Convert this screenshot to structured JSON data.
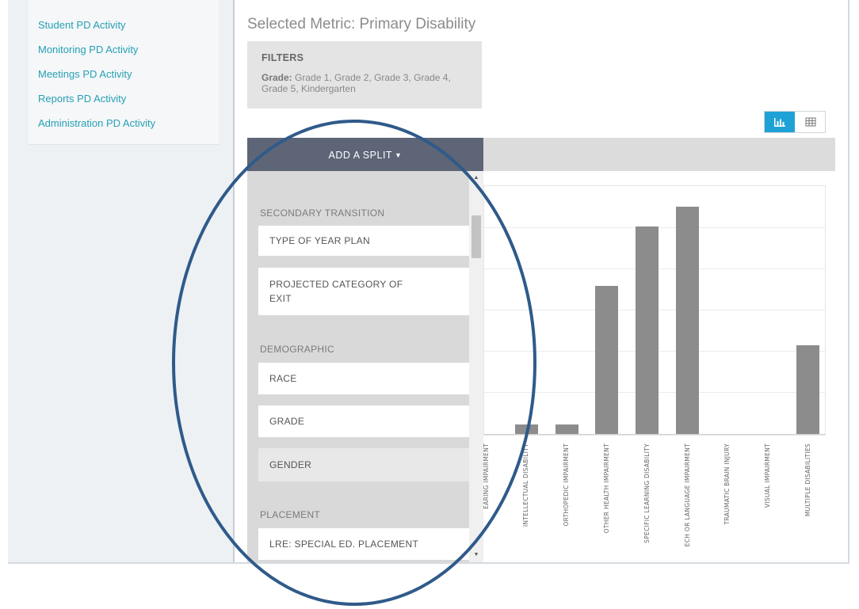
{
  "sidebar": {
    "links": [
      "Student PD Activity",
      "Monitoring PD Activity",
      "Meetings PD Activity",
      "Reports PD Activity",
      "Administration PD Activity"
    ]
  },
  "header": {
    "title": "Selected Metric: Primary Disability"
  },
  "filters": {
    "title": "FILTERS",
    "grade_label": "Grade:",
    "grade_value": "Grade 1, Grade 2, Grade 3, Grade 4, Grade 5, Kindergarten"
  },
  "view_toggle": {
    "chart_icon": "bar-chart-icon",
    "table_icon": "table-grid-icon",
    "active": "chart",
    "active_color": "#1ea2d6"
  },
  "split": {
    "button_label": "ADD A SPLIT",
    "caret_icon": "caret-down-icon"
  },
  "dropdown": {
    "sections": [
      {
        "label": "SECONDARY TRANSITION",
        "items": [
          "TYPE OF YEAR PLAN",
          "PROJECTED CATEGORY OF EXIT"
        ]
      },
      {
        "label": "DEMOGRAPHIC",
        "items": [
          "RACE",
          "GRADE",
          "GENDER"
        ]
      },
      {
        "label": "PLACEMENT",
        "items": [
          "LRE: SPECIAL ED. PLACEMENT"
        ]
      }
    ],
    "hovered_item": "GENDER"
  },
  "chart_data": {
    "type": "bar",
    "categories": [
      "HEARING IMPAIRMENT",
      "INTELLECTUAL DISABILITY",
      "ORTHOPEDIC IMPAIRMENT",
      "OTHER HEALTH IMPAIRMENT",
      "SPECIFIC LEARNING DISABILITY",
      "SPEECH OR LANGUAGE IMPAIRMENT",
      "TRAUMATIC BRAIN INJURY",
      "VISUAL IMPAIRMENT",
      "MULTIPLE DISABILITIES"
    ],
    "visible_labels": [
      "EARING IMPAIRMENT",
      "INTELLECTUAL DISABILITY",
      "ORTHOPEDIC IMPAIRMENT",
      "OTHER HEALTH IMPAIRMENT",
      "SPECIFIC LEARNING DISABILITY",
      "ECH OR LANGUAGE IMPAIRMENT",
      "TRAUMATIC BRAIN INJURY",
      "VISUAL IMPAIRMENT",
      "MULTIPLE DISABILITIES"
    ],
    "values": [
      0,
      0.3,
      0.3,
      4.5,
      6.3,
      6.9,
      0,
      0,
      2.7
    ],
    "ylim": [
      0,
      7.5
    ],
    "grid": true,
    "bar_color": "#8c8c8c"
  },
  "annotation": {
    "shape": "ellipse",
    "color": "#2f5a8a"
  }
}
